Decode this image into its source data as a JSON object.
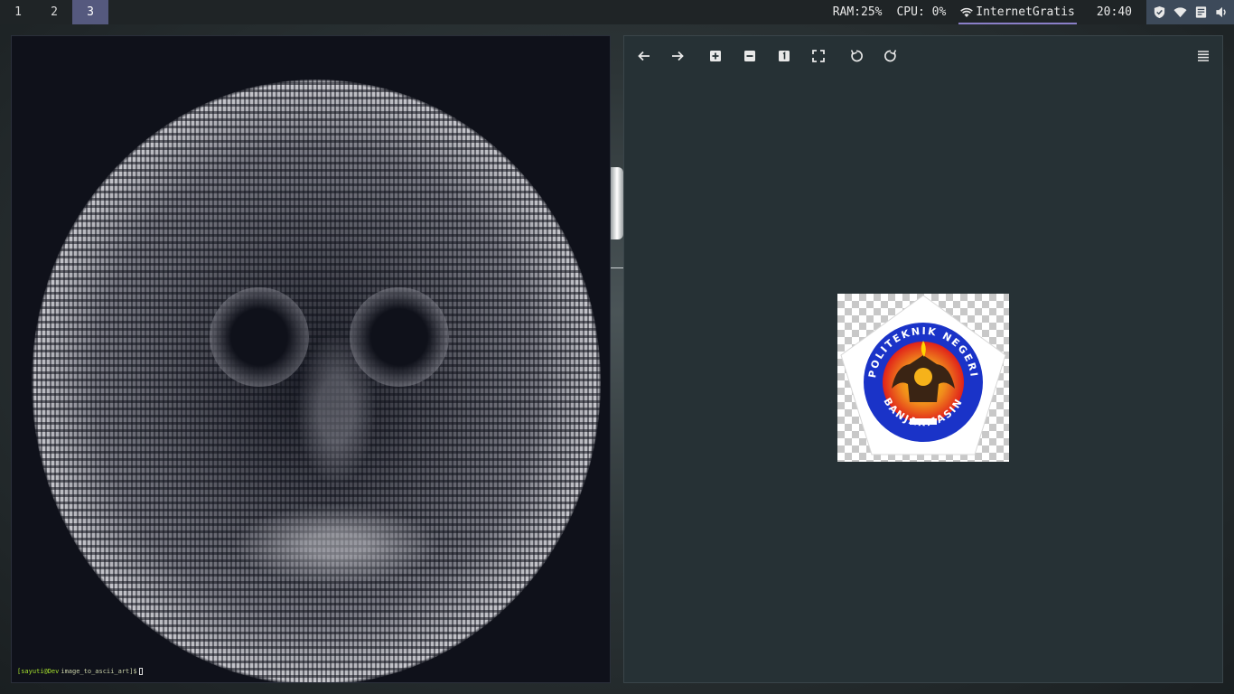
{
  "topbar": {
    "workspaces": [
      "1",
      "2",
      "3"
    ],
    "active_workspace": "3",
    "ram": "RAM:25%",
    "cpu": "CPU: 0%",
    "network": "InternetGratis",
    "clock": "20:40",
    "tray_icons": [
      "shield-icon",
      "wifi-icon",
      "notes-icon",
      "volume-icon"
    ]
  },
  "terminal": {
    "prompt_user": "[sayuti@Dev",
    "prompt_dir": "image_to_ascii_art]$"
  },
  "viewer": {
    "toolbar_icons": [
      "arrow-left-icon",
      "arrow-right-icon",
      "zoom-in-icon",
      "zoom-out-icon",
      "actual-size-icon",
      "fit-window-icon",
      "rotate-left-icon",
      "rotate-right-icon",
      "menu-icon"
    ],
    "logo_text_top": "POLITEKNIK NEGERI",
    "logo_text_bottom": "BANJARMASIN"
  },
  "colors": {
    "accent": "#55597e",
    "terminal_bg": "#0f111a",
    "viewer_bg": "#263135"
  }
}
